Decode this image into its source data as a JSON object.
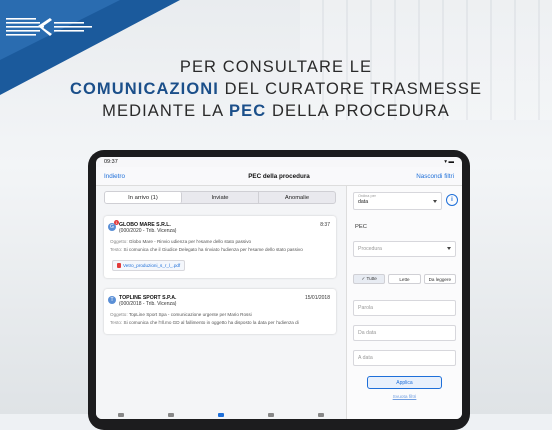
{
  "headline": {
    "line1": "PER CONSULTARE LE",
    "line2_bold": "COMUNICAZIONI",
    "line2_rest": " DEL CURATORE TRASMESSE",
    "line3_start": "MEDIANTE LA ",
    "line3_bold": "PEC",
    "line3_end": " DELLA PROCEDURA"
  },
  "statusbar": {
    "time": "09:37",
    "right": "▾ ▬"
  },
  "navbar": {
    "back": "Indietro",
    "title": "PEC della procedura",
    "hide_filters": "Nascondi filtri"
  },
  "segments": [
    "In arrivo (1)",
    "Inviate",
    "Anomalie"
  ],
  "messages": [
    {
      "avatar": "G",
      "badge": "1",
      "sender": "GLOBO MARE S.R.L.",
      "sub": "(000/2020 - Trib. Vicenza)",
      "date": "8:37",
      "oggetto_label": "Oggetto:",
      "oggetto": "Globo Mare - Rinvio udienza per l'esame dello stato passivo",
      "testo_label": "Testo:",
      "testo": "Si comunica che il Giudice Delegato ha rinviato l'udienza per l'esame dello stato passivo",
      "attachment": "Vetro_produzioni_s_r_l_.pdf"
    },
    {
      "avatar": "T",
      "badge": "",
      "sender": "TOPLINE SPORT S.P.A.",
      "sub": "(000/2018 - Trib. Vicenza)",
      "date": "15/01/2018",
      "oggetto_label": "Oggetto:",
      "oggetto": "TopLine Sport Spa - comunicazione urgente per Mario Rossi",
      "testo_label": "Testo:",
      "testo": "Si comunica che l'Ill.mo GD al fallimento in oggetto ha disposto la data per l'udienza di",
      "attachment": ""
    }
  ],
  "filters": {
    "order_label": "Ordina per",
    "order_value": "data",
    "info_icon": "i",
    "pec_label": "PEC",
    "procedura_placeholder": "Procedura",
    "read_buttons": [
      "✓ Tutte",
      "Lette",
      "Da leggere"
    ],
    "parola_placeholder": "Parola",
    "da_data_placeholder": "Da data",
    "a_data_placeholder": "A data",
    "apply": "Applica",
    "clear": "Svuota filtri"
  }
}
